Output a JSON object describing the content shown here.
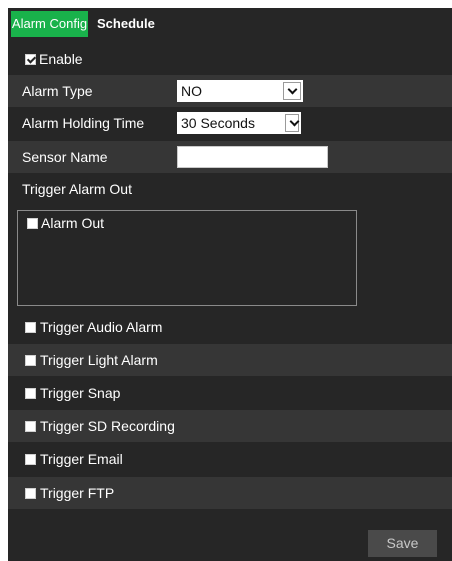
{
  "tabs": {
    "alarm_config": "Alarm Config",
    "schedule": "Schedule"
  },
  "enable": {
    "label": "Enable",
    "checked": true
  },
  "alarm_type": {
    "label": "Alarm Type",
    "value": "NO"
  },
  "alarm_holding_time": {
    "label": "Alarm Holding Time",
    "value": "30 Seconds"
  },
  "sensor_name": {
    "label": "Sensor Name",
    "value": ""
  },
  "trigger_alarm_out": {
    "label": "Trigger Alarm Out",
    "items": [
      {
        "label": "Alarm Out",
        "checked": false
      }
    ]
  },
  "triggers": [
    {
      "label": "Trigger Audio Alarm",
      "checked": false
    },
    {
      "label": "Trigger Light Alarm",
      "checked": false
    },
    {
      "label": "Trigger Snap",
      "checked": false
    },
    {
      "label": "Trigger SD Recording",
      "checked": false
    },
    {
      "label": "Trigger Email",
      "checked": false
    },
    {
      "label": "Trigger FTP",
      "checked": false
    }
  ],
  "save_label": "Save",
  "colors": {
    "accent": "#19b24b",
    "panel_bg": "#262626",
    "row_alt_bg": "#363636",
    "save_bg": "#4a4a4a"
  }
}
